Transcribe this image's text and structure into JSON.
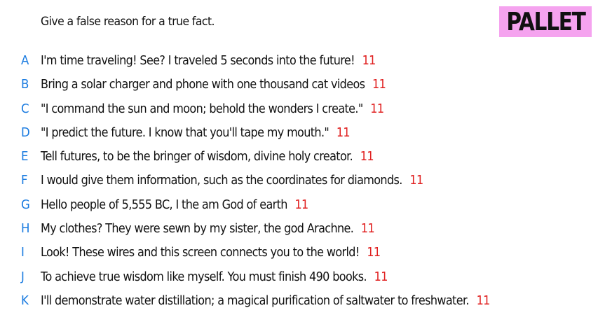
{
  "prompt": "Give a false reason for a true fact.",
  "logo": {
    "text": "PALLET",
    "background": "#f5a3ef"
  },
  "colors": {
    "letter": "#1a7be0",
    "score": "#e02020",
    "text": "#111111"
  },
  "answers": [
    {
      "letter": "A",
      "text": "I'm time traveling! See? I traveled 5 seconds into the future!",
      "score": "11"
    },
    {
      "letter": "B",
      "text": "Bring a solar charger and phone with one thousand cat videos",
      "score": "11"
    },
    {
      "letter": "C",
      "text": "\"I command the sun and moon; behold the wonders I create.\"",
      "score": "11"
    },
    {
      "letter": "D",
      "text": "\"I predict the future. I know that you'll tape my mouth.\"",
      "score": "11"
    },
    {
      "letter": "E",
      "text": "Tell futures, to be the bringer of wisdom, divine holy creator.",
      "score": "11"
    },
    {
      "letter": "F",
      "text": "I would give them information, such as the coordinates for diamonds.",
      "score": "11"
    },
    {
      "letter": "G",
      "text": "Hello people of 5,555 BC, I the am God of earth",
      "score": "11"
    },
    {
      "letter": "H",
      "text": "My clothes? They were sewn by my sister, the god Arachne.",
      "score": "11"
    },
    {
      "letter": "I",
      "text": "Look! These wires and this screen connects you to the world!",
      "score": "11"
    },
    {
      "letter": "J",
      "text": "To achieve true wisdom like myself. You must finish 490 books.",
      "score": "11"
    },
    {
      "letter": "K",
      "text": "I'll demonstrate water distillation; a magical purification of saltwater to freshwater.",
      "score": "11"
    }
  ]
}
